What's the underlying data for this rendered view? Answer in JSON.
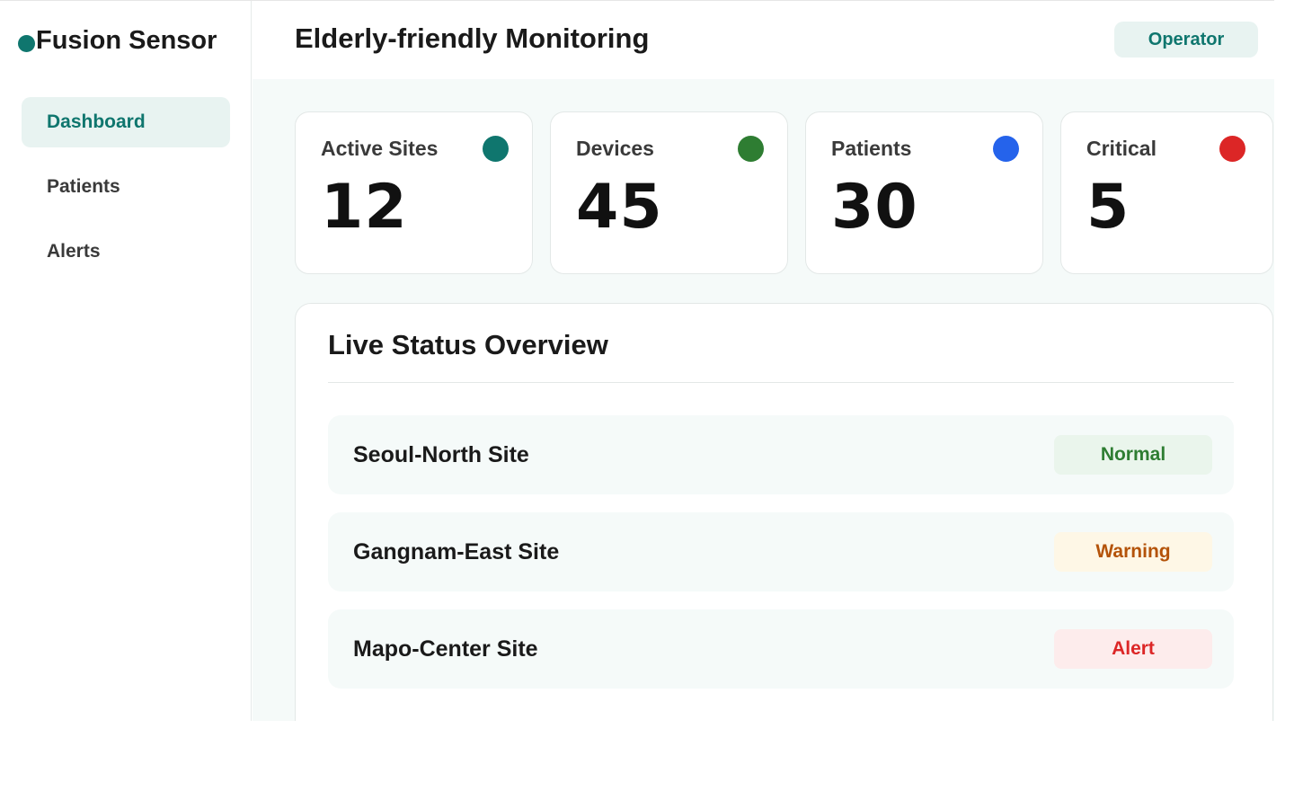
{
  "sidebar": {
    "brand": "Fusion Sensor",
    "items": [
      {
        "label": "Dashboard",
        "active": true
      },
      {
        "label": "Patients",
        "active": false
      },
      {
        "label": "Alerts",
        "active": false
      }
    ]
  },
  "header": {
    "title": "Elderly-friendly Monitoring",
    "role": "Operator"
  },
  "stats": [
    {
      "label": "Active Sites",
      "value": "12",
      "color": "#0f766e"
    },
    {
      "label": "Devices",
      "value": "45",
      "color": "#2e7d32"
    },
    {
      "label": "Patients",
      "value": "30",
      "color": "#2563eb"
    },
    {
      "label": "Critical",
      "value": "5",
      "color": "#dc2626"
    }
  ],
  "overview": {
    "title": "Live Status Overview",
    "sites": [
      {
        "name": "Seoul-North Site",
        "status": "Normal",
        "status_color": "#2e7d32",
        "status_bg": "#eaf5ec"
      },
      {
        "name": "Gangnam-East Site",
        "status": "Warning",
        "status_color": "#b45309",
        "status_bg": "#fef7e6"
      },
      {
        "name": "Mapo-Center Site",
        "status": "Alert",
        "status_color": "#dc2626",
        "status_bg": "#fdecec"
      }
    ]
  },
  "colors": {
    "accent": "#0f766e",
    "accent_bg": "#e8f3f1",
    "main_bg": "#f5faf9"
  }
}
